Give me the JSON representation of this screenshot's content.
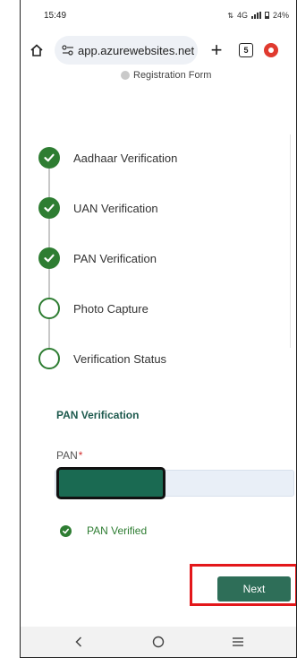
{
  "status": {
    "time": "15:49",
    "right_text": "4G",
    "battery": "24%"
  },
  "browser": {
    "url": "app.azurewebsites.net",
    "tab_count": "5"
  },
  "page": {
    "registration_title": "Registration Form",
    "steps": [
      {
        "label": "Aadhaar Verification",
        "done": true
      },
      {
        "label": "UAN Verification",
        "done": true
      },
      {
        "label": "PAN Verification",
        "done": true
      },
      {
        "label": "Photo Capture",
        "done": false
      },
      {
        "label": "Verification Status",
        "done": false
      }
    ],
    "section_title": "PAN Verification",
    "pan_label": "PAN",
    "pan_required": "*",
    "verified_text": "PAN Verified",
    "next_label": "Next"
  },
  "colors": {
    "accent": "#2e7d32",
    "highlight": "#e3171a"
  }
}
